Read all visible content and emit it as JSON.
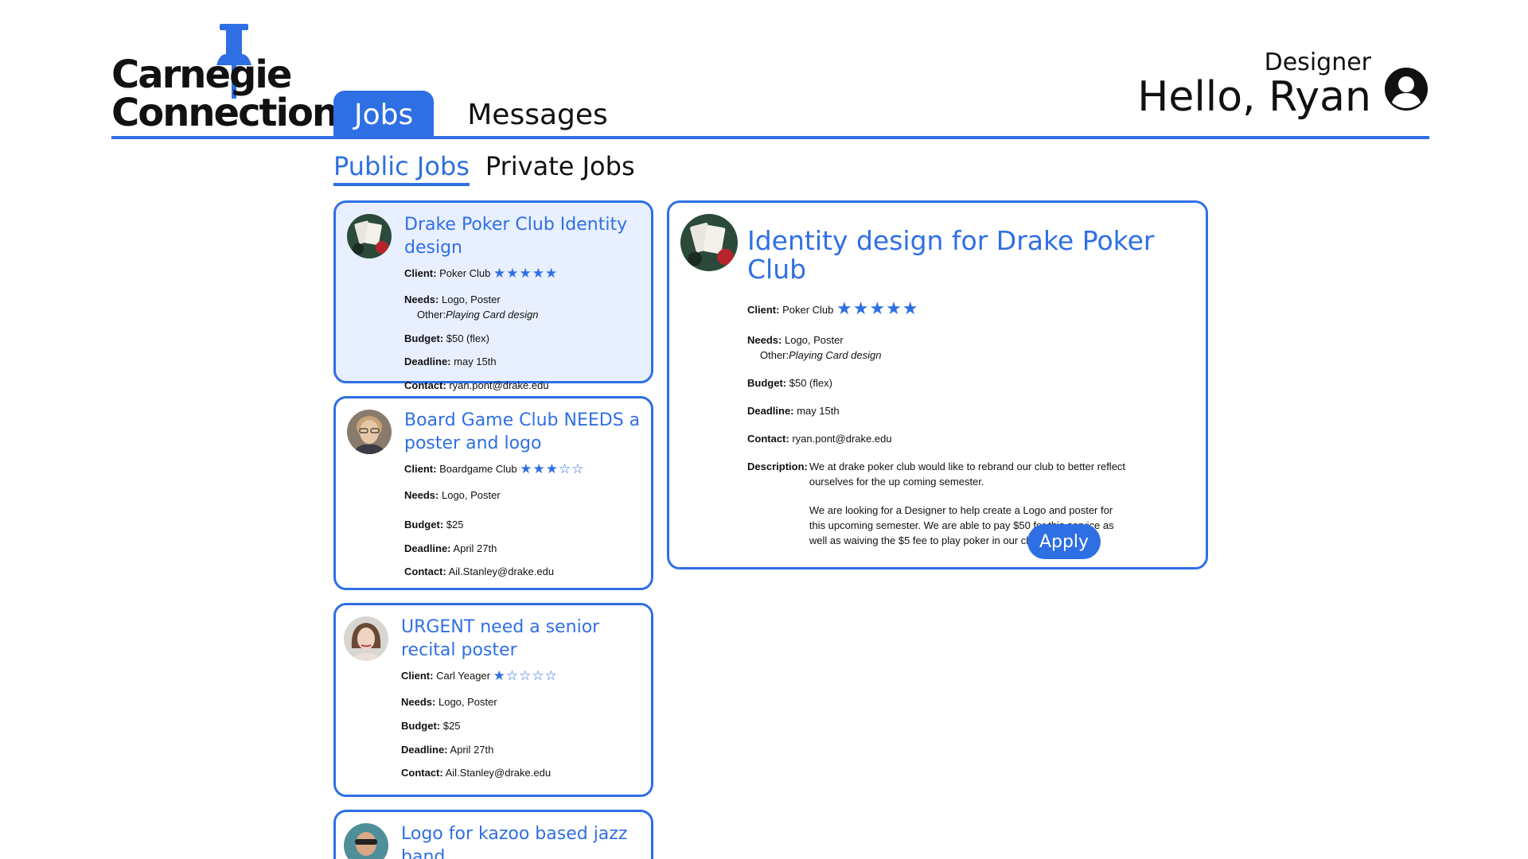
{
  "app": {
    "logo_line1": "Carnegie",
    "logo_line2": "Connections"
  },
  "nav": {
    "tabs": [
      {
        "label": "Jobs",
        "active": true
      },
      {
        "label": "Messages",
        "active": false
      }
    ]
  },
  "user": {
    "role": "Designer",
    "greeting": "Hello, Ryan"
  },
  "subtabs": [
    {
      "label": "Public Jobs",
      "active": true
    },
    {
      "label": "Private Jobs",
      "active": false
    }
  ],
  "labels": {
    "client": "Client:",
    "needs": "Needs:",
    "other": "Other:",
    "budget": "Budget:",
    "deadline": "Deadline:",
    "contact": "Contact:",
    "description": "Description:"
  },
  "jobs": [
    {
      "title": "Drake Poker Club Identity design",
      "client": "Poker Club",
      "rating": 5,
      "stars": "★★★★★",
      "needs": "Logo, Poster",
      "other": "Playing Card design",
      "budget": "$50 (flex)",
      "deadline": "may 15th",
      "contact": "ryan.pont@drake.edu"
    },
    {
      "title": "Board Game Club NEEDS a poster and logo",
      "client": "Boardgame Club",
      "rating": 3,
      "stars": "★★★☆☆",
      "needs": "Logo, Poster",
      "budget": "$25",
      "deadline": "April 27th",
      "contact": "Ail.Stanley@drake.edu"
    },
    {
      "title": "URGENT need a senior recital poster",
      "client": "Carl Yeager",
      "rating": 1,
      "stars": "★☆☆☆☆",
      "needs": "Logo, Poster",
      "budget": "$25",
      "deadline": "April 27th",
      "contact": "Ail.Stanley@drake.edu"
    },
    {
      "title": "Logo for kazoo based jazz band"
    }
  ],
  "detail": {
    "title": "Identity design for Drake Poker Club",
    "client": "Poker Club",
    "rating": 5,
    "stars": "★★★★★",
    "needs": "Logo, Poster",
    "other": "Playing Card design",
    "budget": "$50 (flex)",
    "deadline": "may 15th",
    "contact": "ryan.pont@drake.edu",
    "description_p1": "We at drake poker club would like to rebrand our club to better reflect ourselves for the up coming semester.",
    "description_p2": "We are looking for a Designer to help create a Logo and poster for this upcoming semester. We are able to pay $50 for this service as well as waiving the $5 fee to play poker in our club.",
    "apply_label": "Apply"
  },
  "colors": {
    "accent": "#2f6fe4",
    "selected_card_bg": "#e8efff"
  }
}
